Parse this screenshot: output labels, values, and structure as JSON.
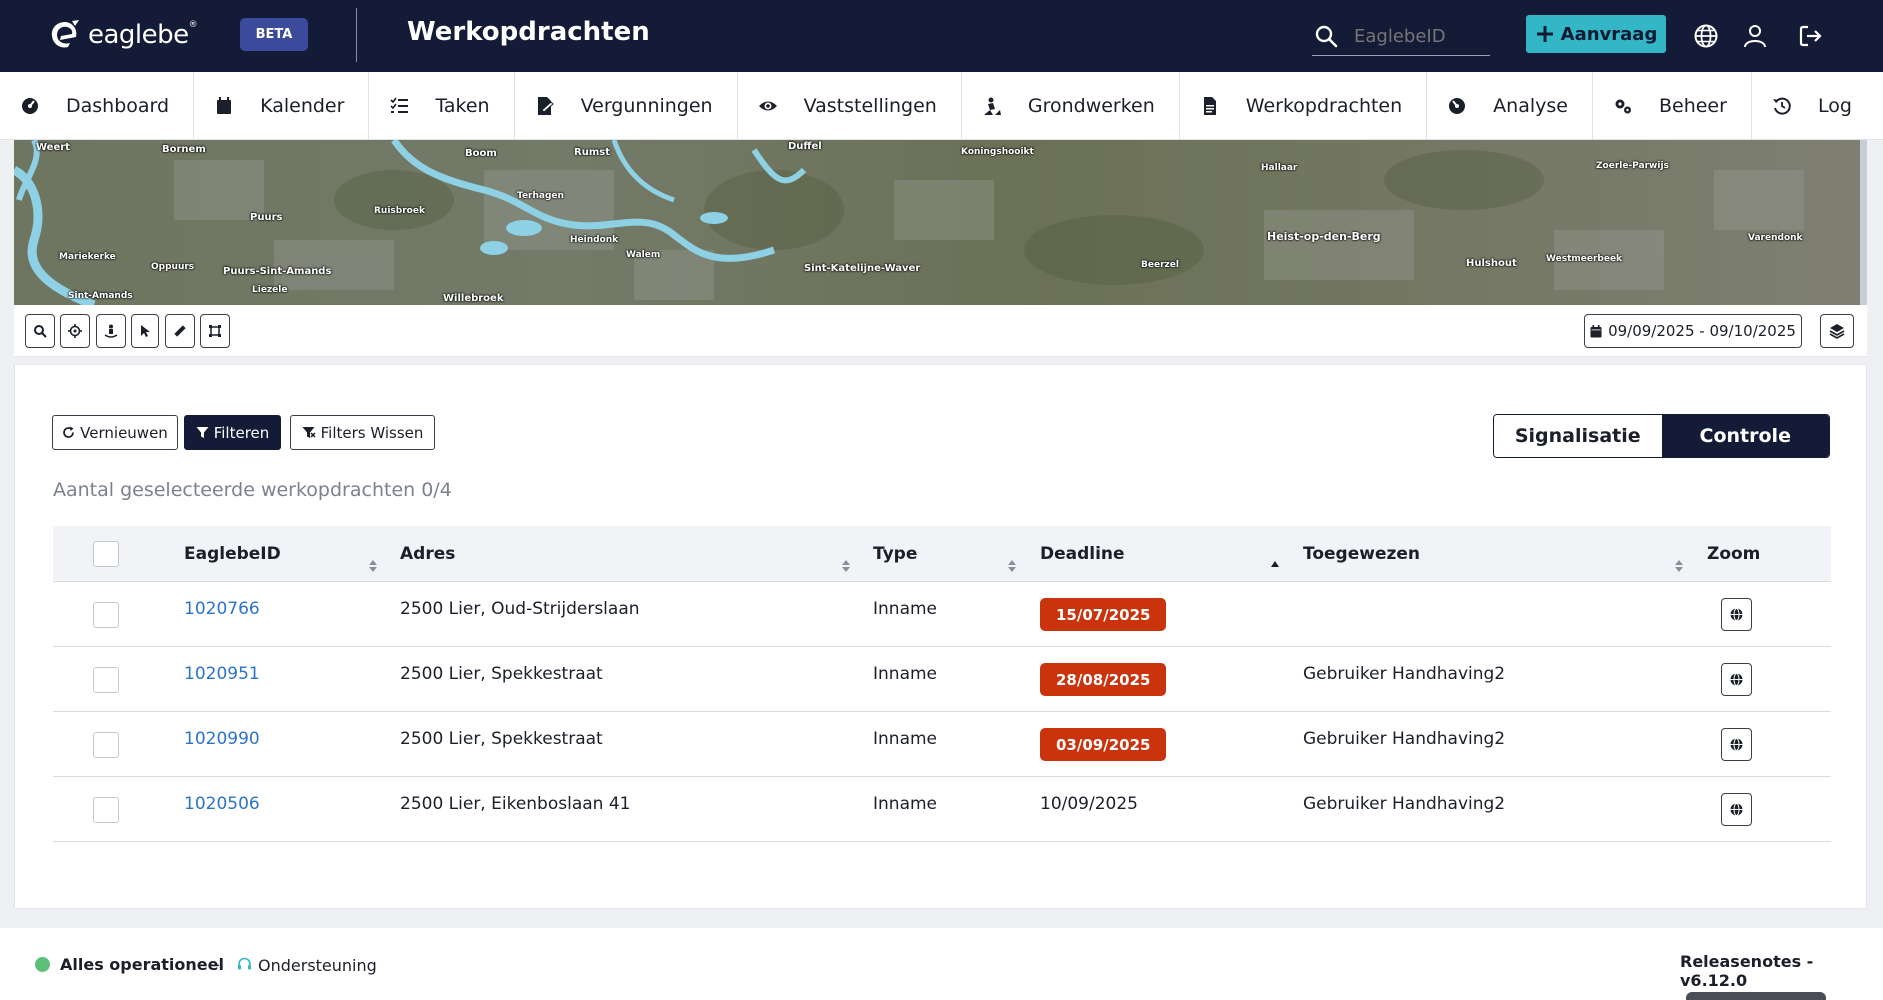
{
  "header": {
    "logo_text": "eaglebe",
    "beta_label": "BETA",
    "page_title": "Werkopdrachten",
    "search_placeholder": "EaglebeID",
    "new_request_label": "Aanvraag"
  },
  "nav": {
    "items": [
      {
        "label": "Dashboard",
        "icon": "dashboard-icon"
      },
      {
        "label": "Kalender",
        "icon": "calendar-icon"
      },
      {
        "label": "Taken",
        "icon": "tasks-icon"
      },
      {
        "label": "Vergunningen",
        "icon": "permits-icon"
      },
      {
        "label": "Vaststellingen",
        "icon": "eye-icon"
      },
      {
        "label": "Grondwerken",
        "icon": "digging-icon"
      },
      {
        "label": "Werkopdrachten",
        "icon": "document-icon"
      },
      {
        "label": "Analyse",
        "icon": "analysis-icon"
      },
      {
        "label": "Beheer",
        "icon": "gears-icon"
      },
      {
        "label": "Log",
        "icon": "history-icon"
      }
    ]
  },
  "map": {
    "labels": [
      "Weert",
      "Bornem",
      "Boom",
      "Rumst",
      "Duffel",
      "Koningshooikt",
      "Hallaar",
      "Zoerle-Parwijs",
      "Terhagen",
      "Ruisbroek",
      "Puurs",
      "Heindonk",
      "Mariekerke",
      "Oppuurs",
      "Puurs-Sint-Amands",
      "Liezele",
      "Sint-Amands",
      "Willebroek",
      "Walem",
      "Sint-Katelijne-Waver",
      "Beerzel",
      "Heist-op-den-Berg",
      "Hulshout",
      "Westmeerbeek",
      "Varendonk"
    ]
  },
  "map_toolbar": {
    "date_range": "09/09/2025 - 09/10/2025"
  },
  "actions": {
    "refresh_label": "Vernieuwen",
    "filter_label": "Filteren",
    "clear_filters_label": "Filters Wissen"
  },
  "mode_toggle": {
    "options": [
      "Signalisatie",
      "Controle"
    ],
    "active": "Controle"
  },
  "selection_count": "Aantal geselecteerde werkopdrachten 0/4",
  "table": {
    "columns": [
      "EaglebeID",
      "Adres",
      "Type",
      "Deadline",
      "Toegewezen",
      "Zoom"
    ],
    "rows": [
      {
        "id": "1020766",
        "address": "2500 Lier, Oud-Strijderslaan",
        "type": "Inname",
        "deadline": "15/07/2025",
        "overdue": true,
        "assigned": ""
      },
      {
        "id": "1020951",
        "address": "2500 Lier, Spekkestraat",
        "type": "Inname",
        "deadline": "28/08/2025",
        "overdue": true,
        "assigned": "Gebruiker Handhaving2"
      },
      {
        "id": "1020990",
        "address": "2500 Lier, Spekkestraat",
        "type": "Inname",
        "deadline": "03/09/2025",
        "overdue": true,
        "assigned": "Gebruiker Handhaving2"
      },
      {
        "id": "1020506",
        "address": "2500 Lier, Eikenboslaan 41",
        "type": "Inname",
        "deadline": "10/09/2025",
        "overdue": false,
        "assigned": "Gebruiker Handhaving2"
      }
    ]
  },
  "footer": {
    "status_label": "Alles operationeel",
    "separator": "-",
    "support_label": "Ondersteuning",
    "release_notes": "Releasenotes - v6.12.0"
  },
  "colors": {
    "header_bg": "#141b36",
    "accent": "#33b6c6",
    "overdue_badge": "#c9340d",
    "link": "#2b74c7",
    "status_ok": "#5cc07a"
  }
}
